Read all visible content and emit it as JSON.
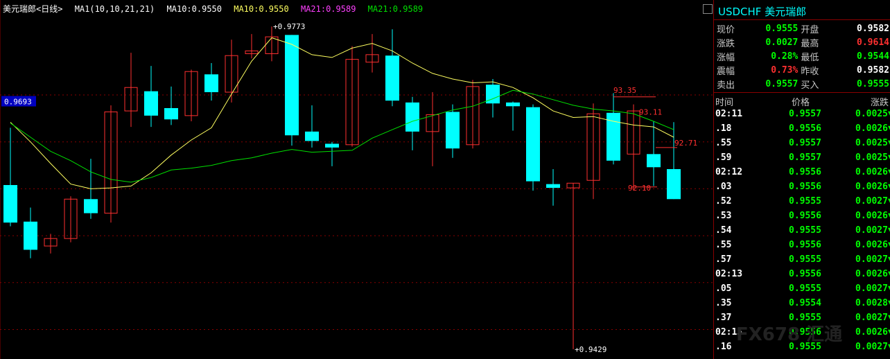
{
  "header": {
    "name": "美元瑞郎<日线>",
    "ma_params": "MA1(10,10,21,21)",
    "ma10_a": "MA10:0.9550",
    "ma10_b": "MA10:0.9550",
    "ma21_a": "MA21:0.9589",
    "ma21_b": "MA21:0.9589"
  },
  "colors": {
    "up": "#ff3030",
    "down": "#00ffff",
    "ma10": "#ffff60",
    "ma21": "#00e000",
    "grid": "#8a0000"
  },
  "chart_data": {
    "type": "candlestick",
    "ylim": [
      0.9423,
      0.9785
    ],
    "y_label_price": "0.9693",
    "high_label": "0.9773",
    "low_label": "0.9429",
    "annotations": [
      "93.35",
      "93.11",
      "92.71",
      "92.10"
    ],
    "candles": [
      {
        "o": 0.9604,
        "h": 0.9665,
        "l": 0.956,
        "c": 0.9564
      },
      {
        "o": 0.9565,
        "h": 0.958,
        "l": 0.9526,
        "c": 0.9535
      },
      {
        "o": 0.9539,
        "h": 0.9552,
        "l": 0.9531,
        "c": 0.9547
      },
      {
        "o": 0.9547,
        "h": 0.9592,
        "l": 0.9543,
        "c": 0.9589
      },
      {
        "o": 0.9589,
        "h": 0.9632,
        "l": 0.9568,
        "c": 0.9574
      },
      {
        "o": 0.9574,
        "h": 0.9689,
        "l": 0.9564,
        "c": 0.9682
      },
      {
        "o": 0.9683,
        "h": 0.9745,
        "l": 0.9666,
        "c": 0.9708
      },
      {
        "o": 0.9704,
        "h": 0.9731,
        "l": 0.9666,
        "c": 0.9678
      },
      {
        "o": 0.9686,
        "h": 0.9709,
        "l": 0.9668,
        "c": 0.9674
      },
      {
        "o": 0.9678,
        "h": 0.9727,
        "l": 0.9672,
        "c": 0.9725
      },
      {
        "o": 0.9722,
        "h": 0.9734,
        "l": 0.9694,
        "c": 0.9703
      },
      {
        "o": 0.9703,
        "h": 0.9759,
        "l": 0.9692,
        "c": 0.9742
      },
      {
        "o": 0.9744,
        "h": 0.9765,
        "l": 0.9739,
        "c": 0.9747
      },
      {
        "o": 0.9744,
        "h": 0.9773,
        "l": 0.9736,
        "c": 0.9762
      },
      {
        "o": 0.9764,
        "h": 0.9754,
        "l": 0.9646,
        "c": 0.9657
      },
      {
        "o": 0.9661,
        "h": 0.9689,
        "l": 0.9644,
        "c": 0.9651
      },
      {
        "o": 0.9648,
        "h": 0.965,
        "l": 0.9624,
        "c": 0.9644
      },
      {
        "o": 0.9647,
        "h": 0.9752,
        "l": 0.9645,
        "c": 0.9738
      },
      {
        "o": 0.9735,
        "h": 0.9765,
        "l": 0.9724,
        "c": 0.9743
      },
      {
        "o": 0.9742,
        "h": 0.977,
        "l": 0.9688,
        "c": 0.9694
      },
      {
        "o": 0.9692,
        "h": 0.9698,
        "l": 0.9641,
        "c": 0.9661
      },
      {
        "o": 0.9661,
        "h": 0.9703,
        "l": 0.9624,
        "c": 0.9679
      },
      {
        "o": 0.9682,
        "h": 0.969,
        "l": 0.9633,
        "c": 0.9643
      },
      {
        "o": 0.9647,
        "h": 0.9716,
        "l": 0.9643,
        "c": 0.9709
      },
      {
        "o": 0.9711,
        "h": 0.9717,
        "l": 0.9676,
        "c": 0.9691
      },
      {
        "o": 0.9692,
        "h": 0.9693,
        "l": 0.9662,
        "c": 0.9688
      },
      {
        "o": 0.9687,
        "h": 0.969,
        "l": 0.9598,
        "c": 0.9608
      },
      {
        "o": 0.9605,
        "h": 0.9621,
        "l": 0.9582,
        "c": 0.9601
      },
      {
        "o": 0.9601,
        "h": 0.9606,
        "l": 0.9429,
        "c": 0.9606
      },
      {
        "o": 0.9609,
        "h": 0.9691,
        "l": 0.9589,
        "c": 0.968
      },
      {
        "o": 0.9681,
        "h": 0.9702,
        "l": 0.9626,
        "c": 0.963
      },
      {
        "o": 0.9637,
        "h": 0.969,
        "l": 0.9599,
        "c": 0.9683
      },
      {
        "o": 0.9637,
        "h": 0.9672,
        "l": 0.9603,
        "c": 0.9623
      },
      {
        "o": 0.9621,
        "h": 0.9671,
        "l": 0.9599,
        "c": 0.9589
      }
    ],
    "ma10": [
      0.9671,
      0.965,
      0.9627,
      0.9605,
      0.96,
      0.9601,
      0.9603,
      0.9617,
      0.9636,
      0.9652,
      0.9665,
      0.9701,
      0.9736,
      0.9761,
      0.9754,
      0.9743,
      0.974,
      0.975,
      0.9755,
      0.9747,
      0.9734,
      0.9723,
      0.9717,
      0.9713,
      0.9714,
      0.9708,
      0.9697,
      0.9683,
      0.9676,
      0.9677,
      0.9672,
      0.9668,
      0.9666,
      0.9655
    ],
    "ma21": [
      0.967,
      0.9655,
      0.964,
      0.963,
      0.9618,
      0.961,
      0.9607,
      0.9612,
      0.962,
      0.9622,
      0.9625,
      0.963,
      0.9633,
      0.9638,
      0.9642,
      0.9639,
      0.964,
      0.9641,
      0.9654,
      0.9663,
      0.9672,
      0.9678,
      0.9684,
      0.9688,
      0.9696,
      0.9705,
      0.9701,
      0.9695,
      0.9689,
      0.9685,
      0.9683,
      0.968,
      0.9672,
      0.9663
    ]
  },
  "panel": {
    "symbol": "USDCHF",
    "name": "美元瑞郎",
    "quote": [
      {
        "l1": "现价",
        "v1": "0.9555",
        "c1": "g",
        "l2": "开盘",
        "v2": "0.9582",
        "c2": "w"
      },
      {
        "l1": "涨跌",
        "v1": "0.0027",
        "c1": "g",
        "l2": "最高",
        "v2": "0.9614",
        "c2": "r"
      },
      {
        "l1": "涨幅",
        "v1": "0.28%",
        "c1": "g",
        "l2": "最低",
        "v2": "0.9544",
        "c2": "g"
      },
      {
        "l1": "震幅",
        "v1": "0.73%",
        "c1": "r",
        "l2": "昨收",
        "v2": "0.9582",
        "c2": "w"
      },
      {
        "l1": "卖出",
        "v1": "0.9557",
        "c1": "g",
        "l2": "买入",
        "v2": "0.9555",
        "c2": "g"
      }
    ],
    "tick_header": {
      "time": "时间",
      "price": "价格",
      "change": "涨跌"
    },
    "ticks": [
      {
        "t": "02:11",
        "p": "0.9557",
        "c": "0.0025▼"
      },
      {
        "t": ".18",
        "p": "0.9556",
        "c": "0.0026▼"
      },
      {
        "t": ".55",
        "p": "0.9557",
        "c": "0.0025▼"
      },
      {
        "t": ".59",
        "p": "0.9557",
        "c": "0.0025▼"
      },
      {
        "t": "02:12",
        "p": "0.9556",
        "c": "0.0026▼"
      },
      {
        "t": ".03",
        "p": "0.9556",
        "c": "0.0026▼"
      },
      {
        "t": ".52",
        "p": "0.9555",
        "c": "0.0027▼"
      },
      {
        "t": ".53",
        "p": "0.9556",
        "c": "0.0026▼"
      },
      {
        "t": ".54",
        "p": "0.9555",
        "c": "0.0027▼"
      },
      {
        "t": ".55",
        "p": "0.9556",
        "c": "0.0026▼"
      },
      {
        "t": ".57",
        "p": "0.9555",
        "c": "0.0027▼"
      },
      {
        "t": "02:13",
        "p": "0.9556",
        "c": "0.0026▼"
      },
      {
        "t": ".05",
        "p": "0.9555",
        "c": "0.0027▼"
      },
      {
        "t": ".35",
        "p": "0.9554",
        "c": "0.0028▼"
      },
      {
        "t": ".37",
        "p": "0.9555",
        "c": "0.0027▼"
      },
      {
        "t": "02:15",
        "p": "0.9556",
        "c": "0.0026▼"
      },
      {
        "t": ".16",
        "p": "0.9555",
        "c": "0.0027▼"
      }
    ]
  },
  "watermark": "FX678 汇通"
}
